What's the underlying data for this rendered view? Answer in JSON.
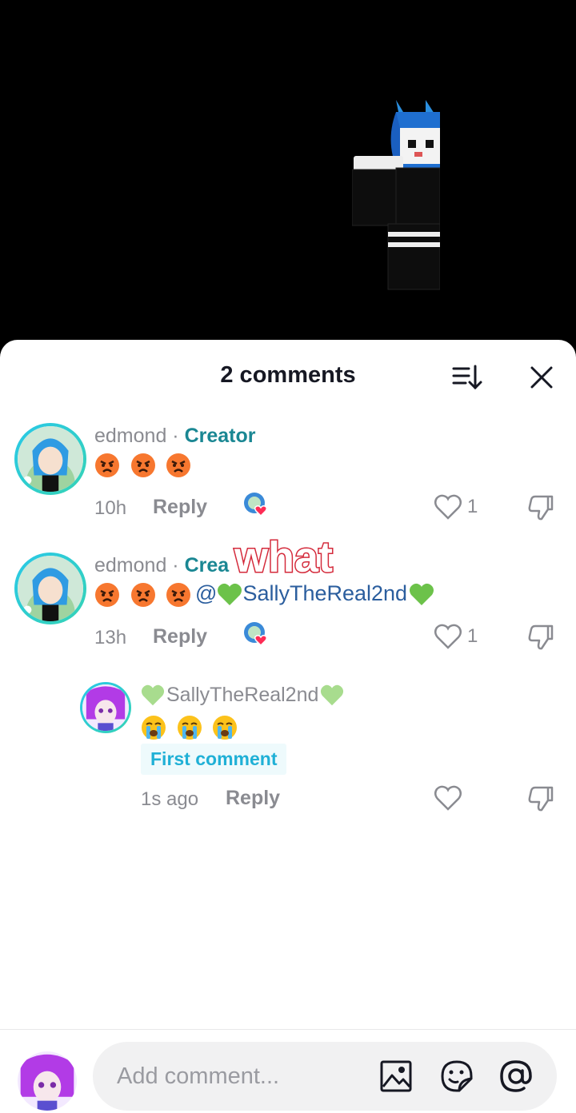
{
  "header": {
    "title": "2 comments"
  },
  "overlay": {
    "text": "what"
  },
  "comments": [
    {
      "username": "edmond",
      "separator": " · ",
      "role": "Creator",
      "text_emojis": [
        "angry-face",
        "angry-face",
        "angry-face"
      ],
      "mention": "",
      "time": "10h",
      "reply_label": "Reply",
      "likes": "1"
    },
    {
      "username": "edmond",
      "separator": " · ",
      "role": "Crea",
      "text_emojis": [
        "angry-face",
        "angry-face",
        "angry-face"
      ],
      "mention_prefix": "@",
      "mention_name": "SallyTheReal2nd",
      "time": "13h",
      "reply_label": "Reply",
      "likes": "1"
    }
  ],
  "reply": {
    "username": "SallyTheReal2nd",
    "text_emojis": [
      "crying-face",
      "crying-face",
      "crying-face"
    ],
    "badge": "First comment",
    "time": "1s ago",
    "reply_label": "Reply"
  },
  "composer": {
    "placeholder": "Add comment..."
  },
  "colors": {
    "creator": "#1a8793",
    "mention": "#2b5e9e",
    "badge": "#1fb0d6",
    "like_heart": "#fe2c55"
  }
}
